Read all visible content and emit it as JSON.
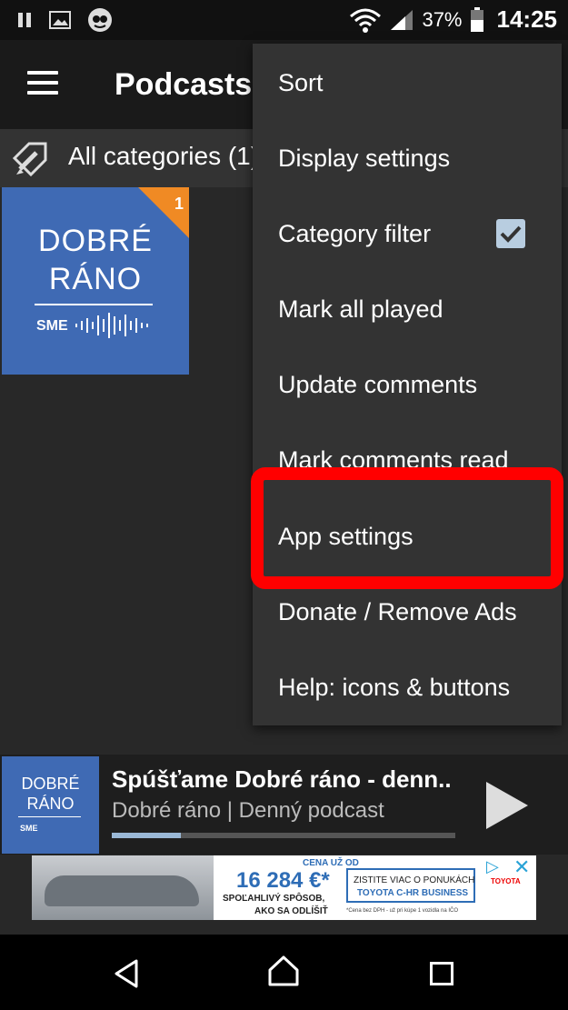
{
  "status_bar": {
    "battery_percent": "37%",
    "time": "14:25",
    "icons": [
      "pause-icon",
      "image-icon",
      "podcast-app-icon",
      "wifi-icon",
      "signal-icon",
      "battery-icon"
    ]
  },
  "toolbar": {
    "title": "Podcasts"
  },
  "category_bar": {
    "label": "All categories (1)"
  },
  "podcast_tile": {
    "badge_count": "1",
    "art_line1": "DOBRÉ",
    "art_line2": "RÁNO",
    "art_brand": "SME"
  },
  "menu": {
    "items": [
      {
        "label": "Sort"
      },
      {
        "label": "Display settings"
      },
      {
        "label": "Category filter",
        "checked": true
      },
      {
        "label": "Mark all played"
      },
      {
        "label": "Update comments"
      },
      {
        "label": "Mark comments read"
      },
      {
        "label": "App settings",
        "highlighted": true
      },
      {
        "label": "Donate / Remove Ads"
      },
      {
        "label": "Help: icons & buttons"
      }
    ]
  },
  "player": {
    "art_line1": "DOBRÉ",
    "art_line2": "RÁNO",
    "art_brand": "SME",
    "episode_title": "Spúšťame Dobré ráno - denn..",
    "subtitle": "Dobré ráno | Denný podcast",
    "progress_fraction": 0.2
  },
  "ad": {
    "cena": "CENA UŽ OD",
    "price": "16 284 €*",
    "line1": "SPOĽAHLIVÝ SPÔSOB,",
    "line2": "AKO SA ODLÍŠIŤ",
    "box_line1": "ZISTITE VIAC O PONUKÁCH",
    "box_line2": "TOYOTA C-HR BUSINESS",
    "fine_print": "*Cena bez DPH - už pri kúpe 1 vozidla na IČO",
    "brand": "TOYOTA"
  },
  "colors": {
    "accent_blue": "#3f6ab4",
    "badge_orange": "#f08a24",
    "highlight_red": "#ff0000",
    "menu_bg": "#333333"
  }
}
